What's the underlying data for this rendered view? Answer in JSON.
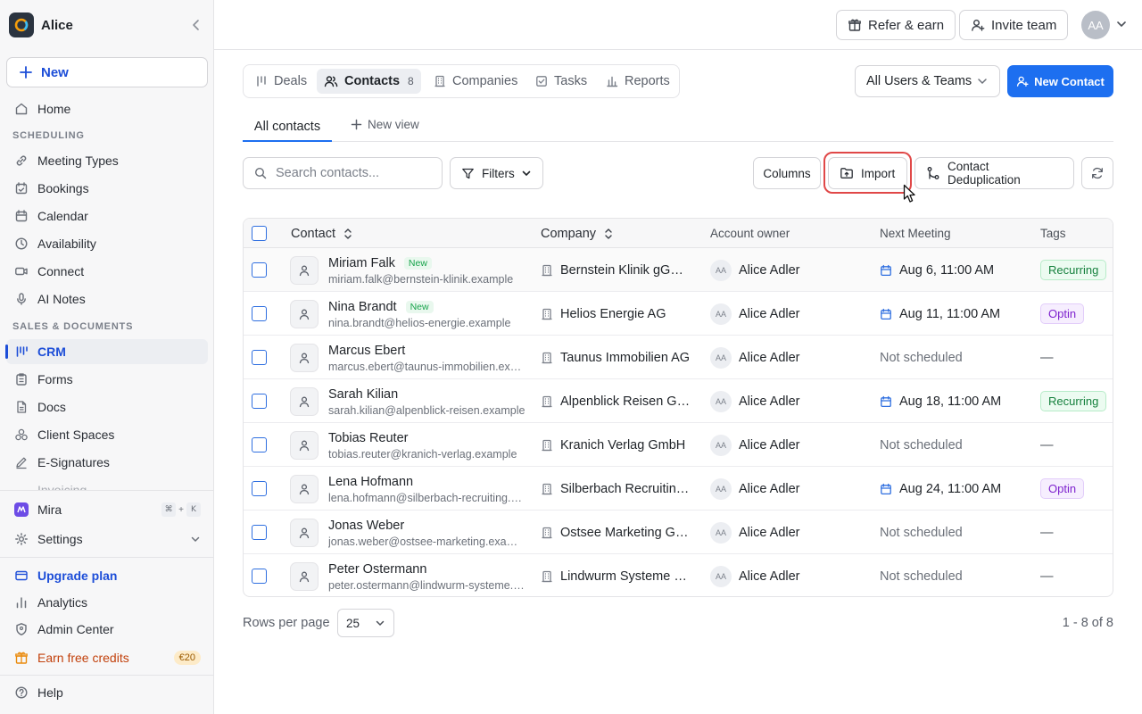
{
  "sidebar": {
    "org_name": "Alice",
    "new_label": "New",
    "home": "Home",
    "section_scheduling": "SCHEDULING",
    "meeting_types": "Meeting Types",
    "bookings": "Bookings",
    "calendar": "Calendar",
    "availability": "Availability",
    "connect": "Connect",
    "ai_notes": "AI Notes",
    "section_sales": "SALES & DOCUMENTS",
    "crm": "CRM",
    "forms": "Forms",
    "docs": "Docs",
    "client_spaces": "Client Spaces",
    "e_signatures": "E-Signatures",
    "invoicing_partial": "Invoicing",
    "mira": "Mira",
    "mira_shortcut_cmd": "⌘",
    "mira_shortcut_plus": "+",
    "mira_shortcut_key": "K",
    "settings": "Settings",
    "upgrade": "Upgrade plan",
    "analytics": "Analytics",
    "admin_center": "Admin Center",
    "earn_credits": "Earn free credits",
    "credits_badge": "€20",
    "help": "Help"
  },
  "header": {
    "refer": "Refer & earn",
    "invite": "Invite team",
    "avatar_initials": "AA"
  },
  "tabs": {
    "deals": "Deals",
    "contacts": "Contacts",
    "contacts_count": "8",
    "companies": "Companies",
    "tasks": "Tasks",
    "reports": "Reports"
  },
  "filters": {
    "users_select": "All Users & Teams",
    "new_contact": "New Contact"
  },
  "views": {
    "all_contacts": "All contacts",
    "new_view": "New view"
  },
  "toolbar": {
    "search_placeholder": "Search contacts...",
    "filters": "Filters",
    "columns": "Columns",
    "import": "Import",
    "dedup": "Contact Deduplication"
  },
  "table": {
    "columns": {
      "contact": "Contact",
      "company": "Company",
      "owner": "Account owner",
      "next_meeting": "Next Meeting",
      "tags": "Tags"
    },
    "rows": [
      {
        "name": "Miriam Falk",
        "badge": "New",
        "email": "miriam.falk@bernstein-klinik.example",
        "company": "Bernstein Klinik gGmbH",
        "owner_initials": "AA",
        "owner": "Alice Adler",
        "meeting": "Aug 6, 11:00 AM",
        "tag": "Recurring"
      },
      {
        "name": "Nina Brandt",
        "badge": "New",
        "email": "nina.brandt@helios-energie.example",
        "company": "Helios Energie AG",
        "owner_initials": "AA",
        "owner": "Alice Adler",
        "meeting": "Aug 11, 11:00 AM",
        "tag": "Optin"
      },
      {
        "name": "Marcus Ebert",
        "badge": "",
        "email": "marcus.ebert@taunus-immobilien.example",
        "company": "Taunus Immobilien AG",
        "owner_initials": "AA",
        "owner": "Alice Adler",
        "meeting": "Not scheduled",
        "tag": "—"
      },
      {
        "name": "Sarah Kilian",
        "badge": "",
        "email": "sarah.kilian@alpenblick-reisen.example",
        "company": "Alpenblick Reisen GmbH",
        "owner_initials": "AA",
        "owner": "Alice Adler",
        "meeting": "Aug 18, 11:00 AM",
        "tag": "Recurring"
      },
      {
        "name": "Tobias Reuter",
        "badge": "",
        "email": "tobias.reuter@kranich-verlag.example",
        "company": "Kranich Verlag GmbH",
        "owner_initials": "AA",
        "owner": "Alice Adler",
        "meeting": "Not scheduled",
        "tag": "—"
      },
      {
        "name": "Lena Hofmann",
        "badge": "",
        "email": "lena.hofmann@silberbach-recruiting.example",
        "company": "Silberbach Recruiting GmbH",
        "owner_initials": "AA",
        "owner": "Alice Adler",
        "meeting": "Aug 24, 11:00 AM",
        "tag": "Optin"
      },
      {
        "name": "Jonas Weber",
        "badge": "",
        "email": "jonas.weber@ostsee-marketing.example",
        "company": "Ostsee Marketing GmbH",
        "owner_initials": "AA",
        "owner": "Alice Adler",
        "meeting": "Not scheduled",
        "tag": "—"
      },
      {
        "name": "Peter Ostermann",
        "badge": "",
        "email": "peter.ostermann@lindwurm-systeme.example",
        "company": "Lindwurm Systeme GmbH",
        "owner_initials": "AA",
        "owner": "Alice Adler",
        "meeting": "Not scheduled",
        "tag": "—"
      }
    ]
  },
  "footer": {
    "rows_per_page_label": "Rows per page",
    "rows_per_page_value": "25",
    "range": "1 - 8 of 8"
  },
  "colors": {
    "accent": "#1d6ff0",
    "highlight": "#e04848",
    "recurring": "#15803d",
    "optin": "#7e22ce"
  }
}
